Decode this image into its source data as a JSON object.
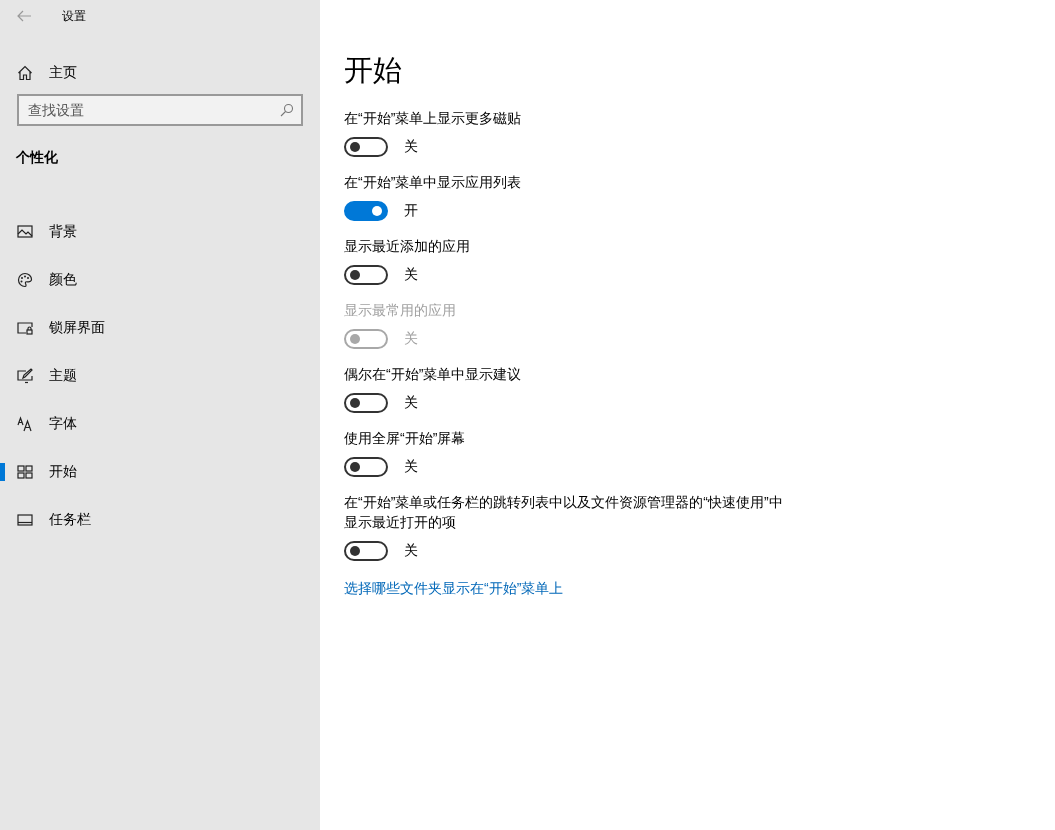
{
  "window": {
    "title": "设置"
  },
  "sidebar": {
    "home": "主页",
    "search": {
      "placeholder": "查找设置"
    },
    "section": "个性化",
    "items": [
      {
        "label": "背景",
        "selected": false
      },
      {
        "label": "颜色",
        "selected": false
      },
      {
        "label": "锁屏界面",
        "selected": false
      },
      {
        "label": "主题",
        "selected": false
      },
      {
        "label": "字体",
        "selected": false
      },
      {
        "label": "开始",
        "selected": true
      },
      {
        "label": "任务栏",
        "selected": false
      }
    ]
  },
  "page": {
    "title": "开始",
    "settings": [
      {
        "label": "在“开始”菜单上显示更多磁贴",
        "on": false,
        "disabled": false,
        "state": "关"
      },
      {
        "label": "在“开始”菜单中显示应用列表",
        "on": true,
        "disabled": false,
        "state": "开"
      },
      {
        "label": "显示最近添加的应用",
        "on": false,
        "disabled": false,
        "state": "关"
      },
      {
        "label": "显示最常用的应用",
        "on": false,
        "disabled": true,
        "state": "关"
      },
      {
        "label": "偶尔在“开始”菜单中显示建议",
        "on": false,
        "disabled": false,
        "state": "关"
      },
      {
        "label": "使用全屏“开始”屏幕",
        "on": false,
        "disabled": false,
        "state": "关"
      },
      {
        "label": "在“开始”菜单或任务栏的跳转列表中以及文件资源管理器的“快速使用”中显示最近打开的项",
        "on": false,
        "disabled": false,
        "state": "关"
      }
    ],
    "link": "选择哪些文件夹显示在“开始”菜单上"
  }
}
